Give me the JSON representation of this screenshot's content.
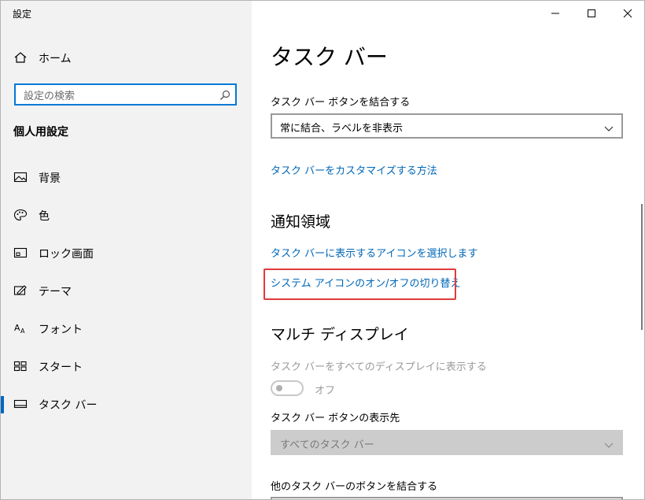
{
  "window": {
    "title": "設定",
    "controls": {
      "minimize": "minimize",
      "maximize": "maximize",
      "close": "close"
    }
  },
  "sidebar": {
    "home": "ホーム",
    "search": {
      "placeholder": "設定の検索",
      "value": ""
    },
    "section_title": "個人用設定",
    "items": [
      {
        "label": "背景",
        "icon": "image-icon"
      },
      {
        "label": "色",
        "icon": "palette-icon"
      },
      {
        "label": "ロック画面",
        "icon": "lock-screen-icon"
      },
      {
        "label": "テーマ",
        "icon": "theme-icon"
      },
      {
        "label": "フォント",
        "icon": "font-icon"
      },
      {
        "label": "スタート",
        "icon": "start-icon"
      },
      {
        "label": "タスク バー",
        "icon": "taskbar-icon",
        "selected": true
      }
    ]
  },
  "main": {
    "page_title": "タスク バー",
    "combine_label": "タスク バー ボタンを結合する",
    "combine_value": "常に結合、ラベルを非表示",
    "customize_link": "タスク バーをカスタマイズする方法",
    "notification_title": "通知領域",
    "select_icons_link": "タスク バーに表示するアイコンを選択します",
    "system_icons_link": "システム アイコンのオン/オフの切り替え",
    "multi_display_title": "マルチ ディスプレイ",
    "show_all_label": "タスク バーをすべてのディスプレイに表示する",
    "toggle_state": "オフ",
    "show_buttons_label": "タスク バー ボタンの表示先",
    "show_buttons_value": "すべてのタスク バー",
    "other_combine_label": "他のタスク バーのボタンを結合する"
  },
  "colors": {
    "accent": "#0067c0",
    "link": "#0067b8",
    "highlight": "#e03a3a",
    "sidebar_bg": "#f2f2f2"
  }
}
